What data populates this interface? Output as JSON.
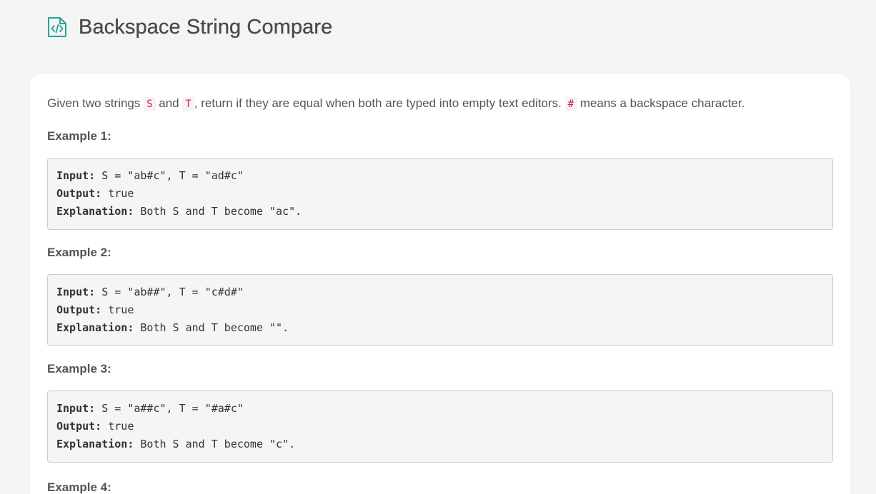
{
  "header": {
    "icon": "code-file-icon",
    "title": "Backspace String Compare"
  },
  "description": {
    "part1": "Given two strings ",
    "s": "S",
    "part2": " and ",
    "t": "T",
    "part3": ", return if they are equal when both are typed into empty text editors. ",
    "hash": "#",
    "part4": " means a backspace character."
  },
  "examples": [
    {
      "title": "Example 1:",
      "input_label": "Input:",
      "input": " S = \"ab#c\", T = \"ad#c\"",
      "output_label": "Output:",
      "output": " true",
      "explanation_label": "Explanation:",
      "explanation": " Both S and T become \"ac\"."
    },
    {
      "title": "Example 2:",
      "input_label": "Input:",
      "input": " S = \"ab##\", T = \"c#d#\"",
      "output_label": "Output:",
      "output": " true",
      "explanation_label": "Explanation:",
      "explanation": " Both S and T become \"\"."
    },
    {
      "title": "Example 3:",
      "input_label": "Input:",
      "input": " S = \"a##c\", T = \"#a#c\"",
      "output_label": "Output:",
      "output": " true",
      "explanation_label": "Explanation:",
      "explanation": " Both S and T become \"c\"."
    },
    {
      "title": "Example 4:"
    }
  ]
}
